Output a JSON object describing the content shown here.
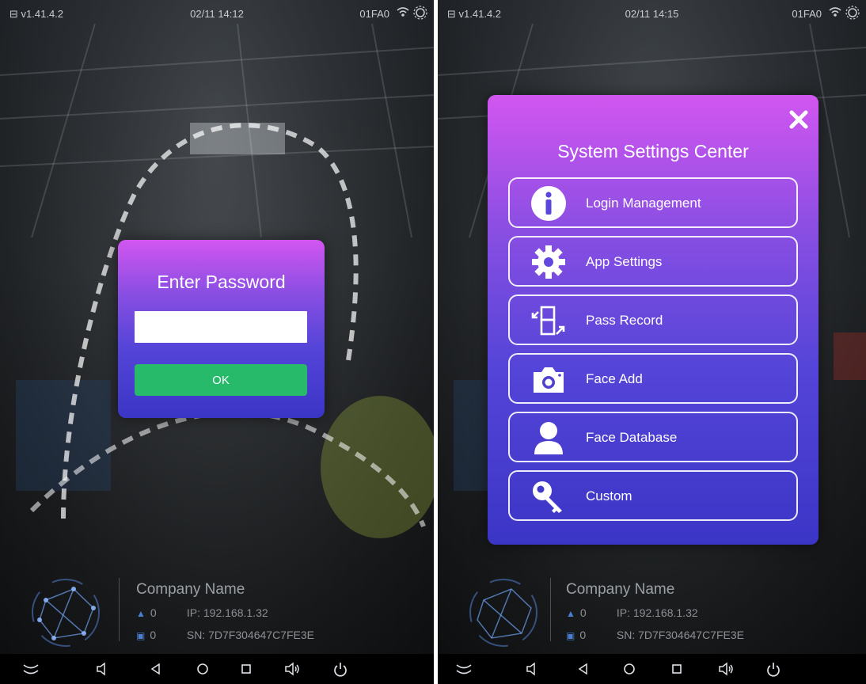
{
  "left": {
    "status": {
      "version": "v1.41.4.2",
      "datetime": "02/11 14:12",
      "device_code": "01FA0"
    },
    "password_dialog": {
      "title": "Enter Password",
      "password_value": "",
      "ok_label": "OK"
    },
    "info": {
      "company_name": "Company Name",
      "person_count": "0",
      "ip_label": "IP:  192.168.1.32",
      "record_count": "0",
      "sn_label": "SN:  7D7F304647C7FE3E"
    }
  },
  "right": {
    "status": {
      "version": "v1.41.4.2",
      "datetime": "02/11 14:15",
      "device_code": "01FA0"
    },
    "settings_dialog": {
      "title": "System Settings Center",
      "items": [
        {
          "label": "Login Management",
          "icon": "info-icon"
        },
        {
          "label": "App Settings",
          "icon": "gear-icon"
        },
        {
          "label": "Pass Record",
          "icon": "pass-record-icon"
        },
        {
          "label": "Face Add",
          "icon": "camera-icon"
        },
        {
          "label": "Face Database",
          "icon": "person-icon"
        },
        {
          "label": "Custom",
          "icon": "key-icon"
        }
      ]
    },
    "info": {
      "company_name": "Company Name",
      "person_count": "0",
      "ip_label": "IP:  192.168.1.32",
      "record_count": "0",
      "sn_label": "SN:  7D7F304647C7FE3E"
    }
  },
  "nav_bar": [
    "collapse-icon",
    "volume-down-icon",
    "back-icon",
    "home-icon",
    "recents-icon",
    "volume-up-icon",
    "power-icon"
  ],
  "colors": {
    "dialog_top": "#d256f0",
    "dialog_bottom": "#3b35c6",
    "ok_button": "#27ba6a"
  }
}
